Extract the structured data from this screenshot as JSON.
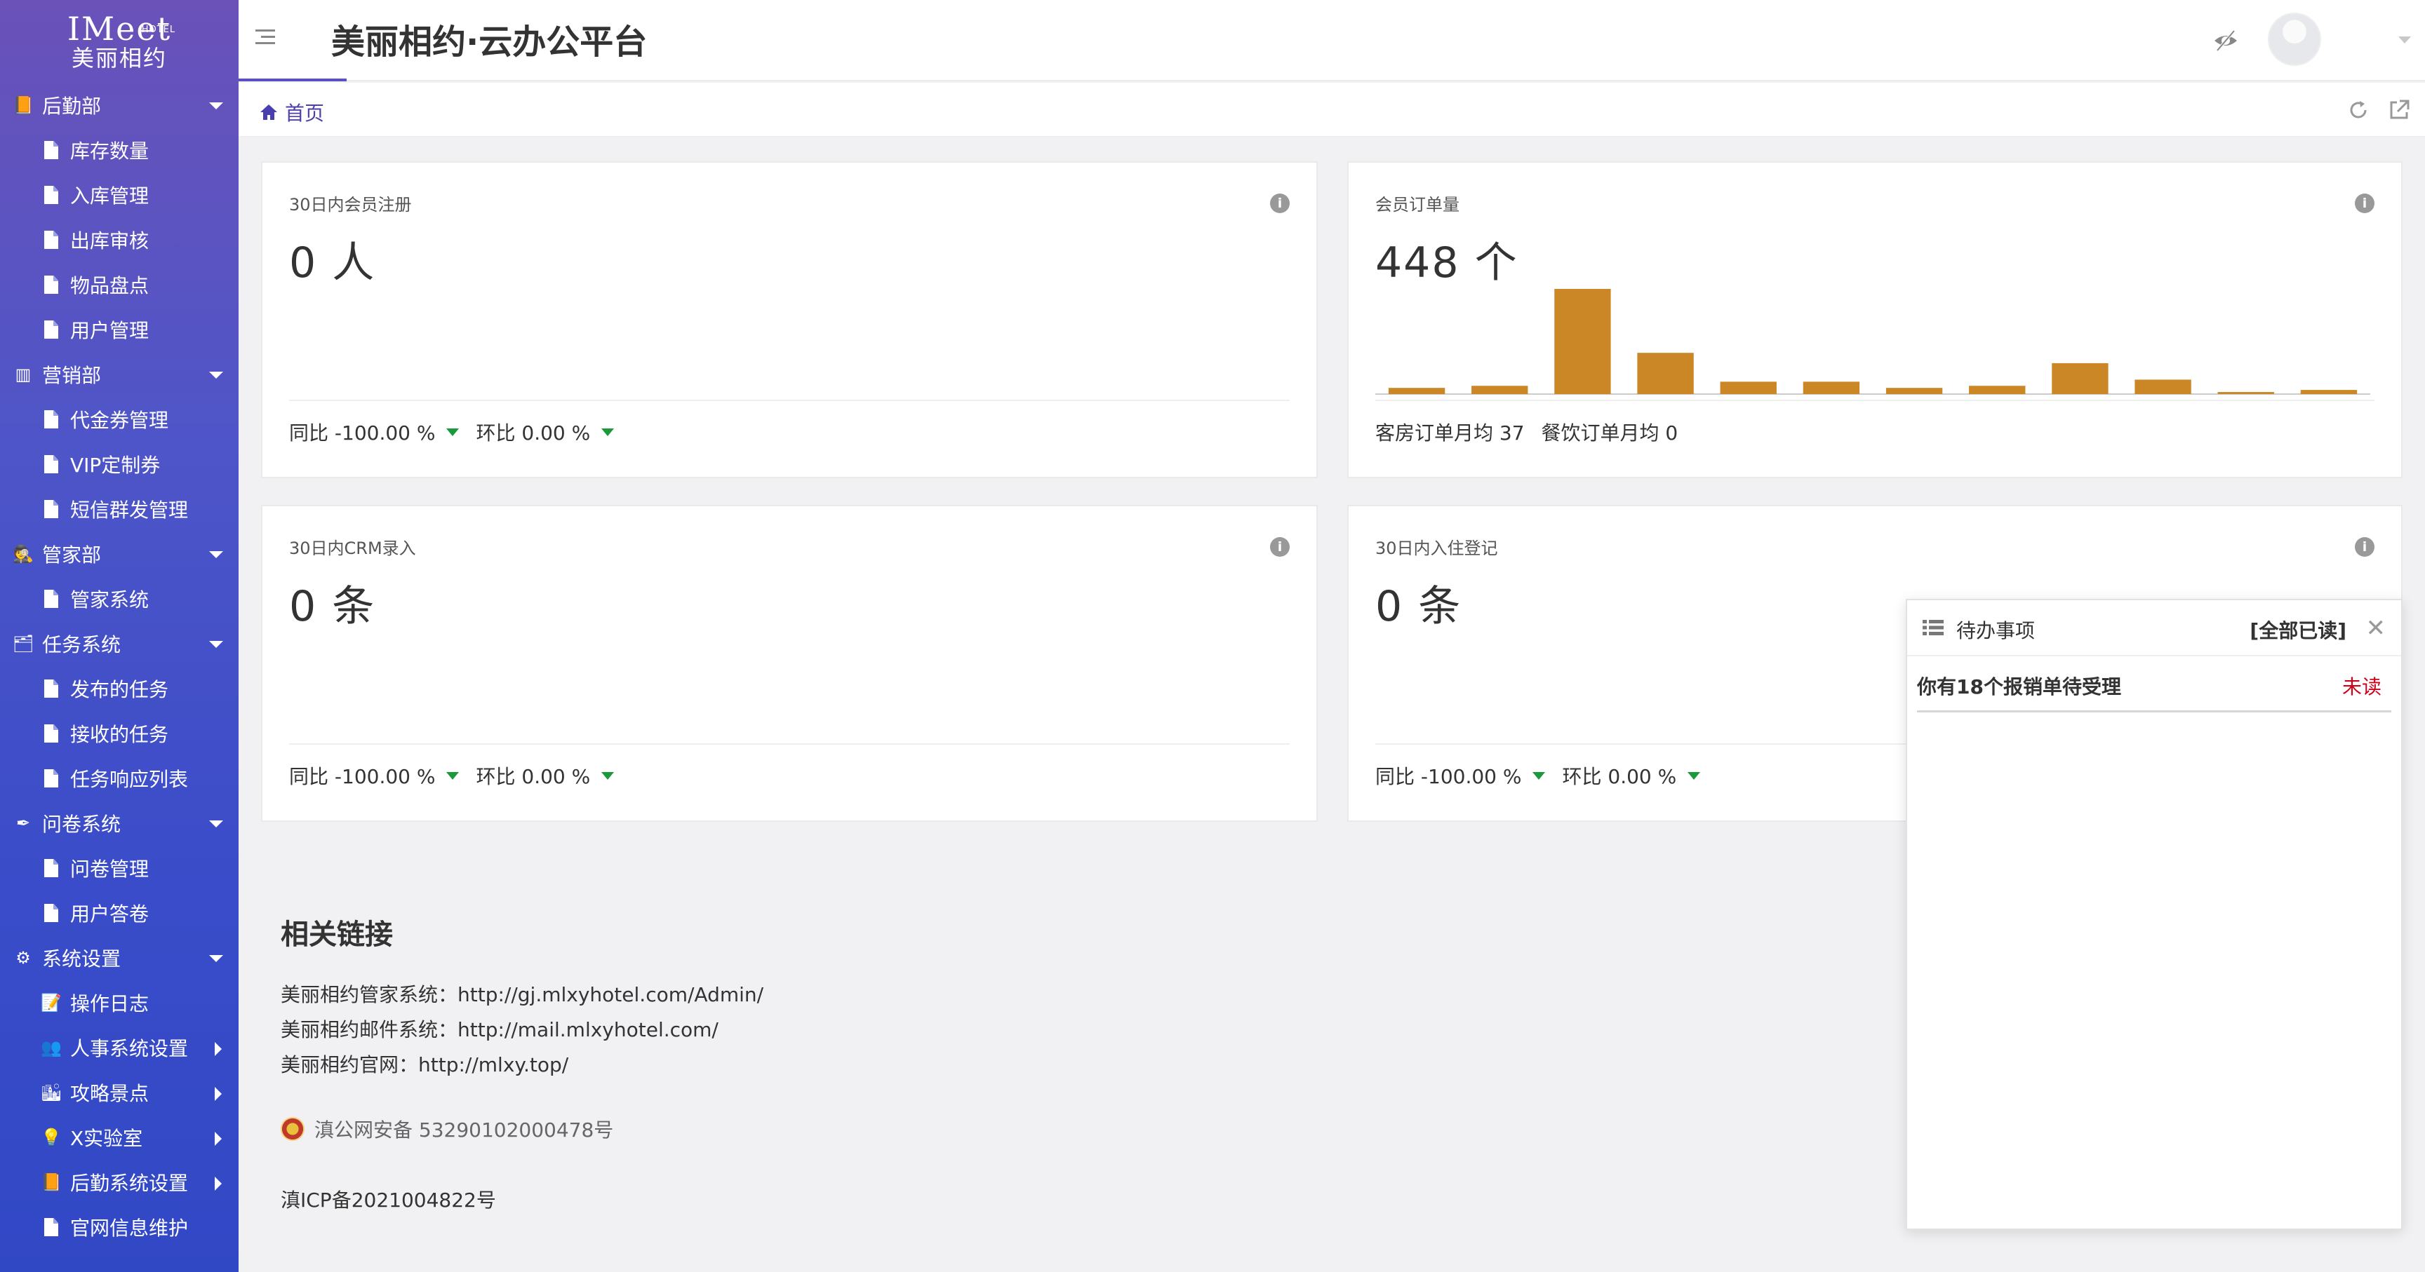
{
  "logo": {
    "brand": "IMeet",
    "small": "HOTEL",
    "cn": "美丽相约"
  },
  "sidebar": {
    "items": [
      {
        "label": "后勤部",
        "type": "group",
        "icon": "logistics-icon",
        "arrow": "down"
      },
      {
        "label": "库存数量",
        "type": "sub",
        "icon": "document-icon"
      },
      {
        "label": "入库管理",
        "type": "sub",
        "icon": "document-icon"
      },
      {
        "label": "出库审核",
        "type": "sub",
        "icon": "document-icon"
      },
      {
        "label": "物品盘点",
        "type": "sub",
        "icon": "document-icon"
      },
      {
        "label": "用户管理",
        "type": "sub",
        "icon": "document-icon"
      },
      {
        "label": "营销部",
        "type": "group",
        "icon": "books-icon",
        "arrow": "down"
      },
      {
        "label": "代金券管理",
        "type": "sub",
        "icon": "document-icon"
      },
      {
        "label": "VIP定制券",
        "type": "sub",
        "icon": "document-icon"
      },
      {
        "label": "短信群发管理",
        "type": "sub",
        "icon": "document-icon"
      },
      {
        "label": "管家部",
        "type": "group",
        "icon": "butler-icon",
        "arrow": "down"
      },
      {
        "label": "管家系统",
        "type": "sub",
        "icon": "document-icon"
      },
      {
        "label": "任务系统",
        "type": "group",
        "icon": "task-icon",
        "arrow": "down"
      },
      {
        "label": "发布的任务",
        "type": "sub",
        "icon": "document-icon"
      },
      {
        "label": "接收的任务",
        "type": "sub",
        "icon": "document-icon"
      },
      {
        "label": "任务响应列表",
        "type": "sub",
        "icon": "document-icon"
      },
      {
        "label": "问卷系统",
        "type": "group",
        "icon": "survey-icon",
        "arrow": "down"
      },
      {
        "label": "问卷管理",
        "type": "sub",
        "icon": "document-icon"
      },
      {
        "label": "用户答卷",
        "type": "sub",
        "icon": "document-icon"
      },
      {
        "label": "系统设置",
        "type": "group",
        "icon": "gear-icon",
        "arrow": "down"
      },
      {
        "label": "操作日志",
        "type": "sub",
        "icon": "log-icon"
      },
      {
        "label": "人事系统设置",
        "type": "sub",
        "icon": "person-icon",
        "arrow": "right"
      },
      {
        "label": "攻略景点",
        "type": "sub",
        "icon": "scenery-icon",
        "arrow": "right"
      },
      {
        "label": "X实验室",
        "type": "sub",
        "icon": "bulb-icon",
        "arrow": "right"
      },
      {
        "label": "后勤系统设置",
        "type": "sub",
        "icon": "logistics-icon",
        "arrow": "right"
      },
      {
        "label": "官网信息维护",
        "type": "sub",
        "icon": "document-icon"
      }
    ]
  },
  "header": {
    "title": "美丽相约·云办公平台"
  },
  "tabs": {
    "home": "首页"
  },
  "cards": {
    "members": {
      "label": "30日内会员注册",
      "value": "0 人",
      "yoy": "同比 -100.00 %",
      "mom": "环比 0.00 %"
    },
    "orders": {
      "label": "会员订单量",
      "value": "448 个",
      "footer_a": "客房订单月均 37",
      "footer_b": "餐饮订单月均 0"
    },
    "crm": {
      "label": "30日内CRM录入",
      "value": "0 条",
      "yoy": "同比 -100.00 %",
      "mom": "环比 0.00 %"
    },
    "checkin": {
      "label": "30日内入住登记",
      "value": "0 条",
      "yoy": "同比 -100.00 %",
      "mom": "环比 0.00 %"
    }
  },
  "chart_data": {
    "type": "bar",
    "values": [
      3,
      4,
      51,
      20,
      6,
      6,
      3,
      4,
      15,
      7,
      1,
      2
    ],
    "color": "#cb8626"
  },
  "links": {
    "title": "相关链接",
    "items": [
      "美丽相约管家系统：http://gj.mlxyhotel.com/Admin/",
      "美丽相约邮件系统：http://mail.mlxyhotel.com/",
      "美丽相约官网：http://mlxy.top/"
    ],
    "beian": "滇公网安备 53290102000478号",
    "icp": "滇ICP备2021004822号"
  },
  "todo": {
    "title": "待办事项",
    "mark_all": "[全部已读]",
    "items": [
      {
        "text": "你有18个报销单待受理",
        "status": "未读"
      }
    ]
  }
}
